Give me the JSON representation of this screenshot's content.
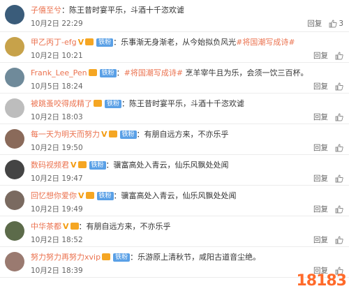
{
  "reply_label": "回复",
  "fan_badge": "铁粉",
  "comments": [
    {
      "name": "子僖至兮",
      "has_v": false,
      "has_crown": false,
      "has_fan": false,
      "text": "陈王昔时宴平乐，斗酒十千恣欢谑",
      "topic": "",
      "text_after": "",
      "date": "10月2日 22:29",
      "likes": "3",
      "avatar_color": "#3a5c7a"
    },
    {
      "name": "甲乙丙丁-efg",
      "has_v": true,
      "has_crown": true,
      "has_fan": true,
      "text": "乐事渐无身渐老，从今始拟负风光",
      "topic": "#将国潮写成诗#",
      "text_after": "",
      "date": "10月2日 10:21",
      "likes": "",
      "avatar_color": "#c7a24a"
    },
    {
      "name": "Frank_Lee_Pen",
      "has_v": false,
      "has_crown": true,
      "has_fan": true,
      "text": "",
      "topic": "#将国潮写成诗#",
      "text_after": " 烹羊宰牛且为乐，会须一饮三百杯。",
      "date": "10月5日 18:24",
      "likes": "",
      "avatar_color": "#6f8a9a"
    },
    {
      "name": "被跳蚤咬得成精了",
      "has_v": false,
      "has_crown": true,
      "has_fan": true,
      "text": "陈王昔时宴平乐，斗酒十千恣欢谑",
      "topic": "",
      "text_after": "",
      "date": "10月2日 18:03",
      "likes": "",
      "avatar_color": "#bdbdbd"
    },
    {
      "name": "每一天为明天而努力",
      "has_v": true,
      "has_crown": true,
      "has_fan": true,
      "text": "有朋自远方来，不亦乐乎",
      "topic": "",
      "text_after": "",
      "date": "10月2日 19:50",
      "likes": "",
      "avatar_color": "#8a6a5a"
    },
    {
      "name": "数码视频君",
      "has_v": true,
      "has_crown": true,
      "has_fan": true,
      "text": "骥富高处入青云，仙乐风飘处处闻",
      "topic": "",
      "text_after": "",
      "date": "10月2日 19:47",
      "likes": "",
      "avatar_color": "#444"
    },
    {
      "name": "回忆想你爱你",
      "has_v": true,
      "has_crown": true,
      "has_fan": true,
      "text": "骥富高处入青云，仙乐风飘处处闻",
      "topic": "",
      "text_after": "",
      "date": "10月2日 19:49",
      "likes": "",
      "avatar_color": "#7a6a60"
    },
    {
      "name": "中华茶都",
      "has_v": true,
      "has_crown": true,
      "has_fan": false,
      "text": "有朋自远方来，不亦乐乎",
      "topic": "",
      "text_after": "",
      "date": "10月2日 18:52",
      "likes": "",
      "avatar_color": "#5c6b4a"
    },
    {
      "name": "努力努力再努力xvip",
      "has_v": false,
      "has_crown": true,
      "has_fan": true,
      "text": "乐游原上清秋节，咸阳古道音尘绝。",
      "topic": "",
      "text_after": "",
      "date": "10月2日 18:39",
      "likes": "",
      "avatar_color": "#9a7a70"
    }
  ],
  "watermark": "18183"
}
